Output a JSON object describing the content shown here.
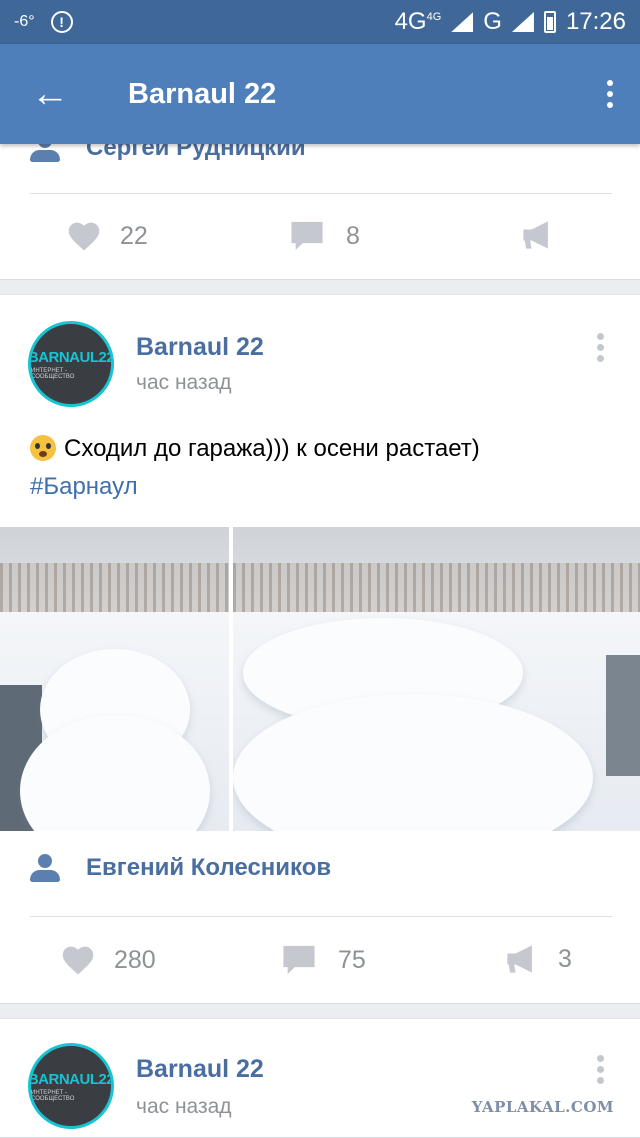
{
  "status": {
    "temperature": "-6°",
    "network1": "4G",
    "network1_sup": "4G",
    "network2": "G",
    "time": "17:26"
  },
  "appbar": {
    "title": "Barnaul 22"
  },
  "prev_post": {
    "author": "Сергей Рудницкий",
    "likes": "22",
    "comments": "8",
    "reposts": ""
  },
  "post": {
    "name": "Barnaul 22",
    "time": "час назад",
    "text": "Сходил до гаража))) к осени растает)",
    "hashtag": "#Барнаул",
    "avatar": {
      "line1": "BARNAUL",
      "line1_num": "22",
      "line2": "ИНТЕРНЕТ - СООБЩЕСТВО"
    },
    "author": "Евгений Колесников",
    "likes": "280",
    "comments": "75",
    "reposts": "3"
  },
  "next_post": {
    "name": "Barnaul 22",
    "time": "час назад"
  },
  "watermark": "YAPLAKAL.COM",
  "colors": {
    "appbar": "#4f7fbb",
    "statusbar": "#3f6898",
    "link": "#4a6ea0"
  }
}
